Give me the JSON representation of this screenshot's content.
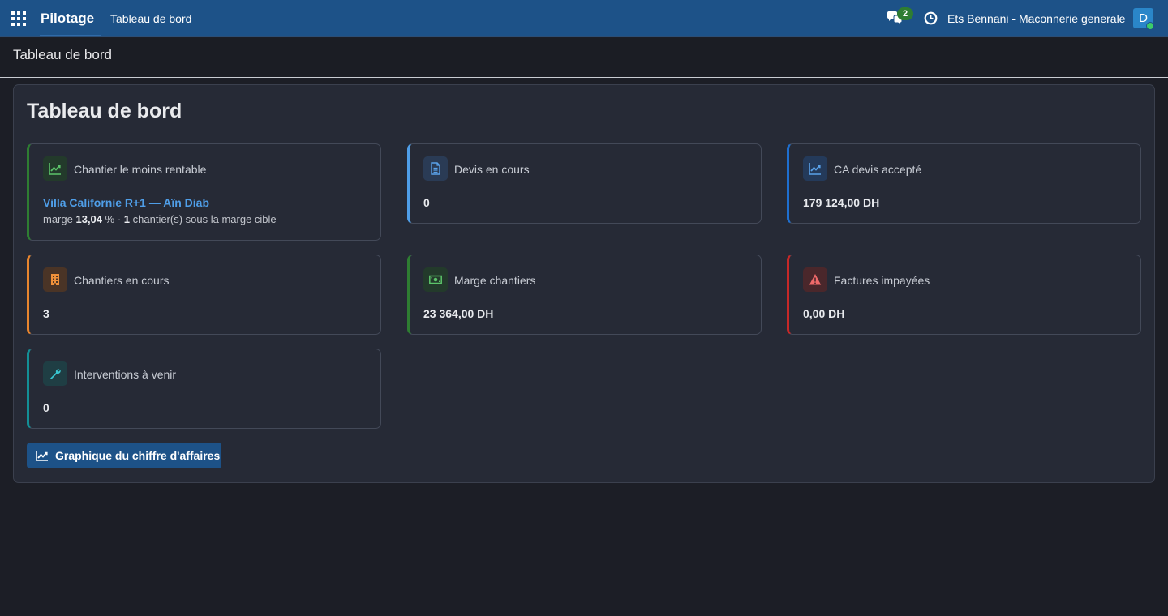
{
  "navbar": {
    "brand": "Pilotage",
    "menu_item": "Tableau de bord",
    "chat_count": "2",
    "company": "Ets Bennani - Maconnerie generale",
    "avatar_initial": "D"
  },
  "breadcrumb": "Tableau de bord",
  "dashboard": {
    "title": "Tableau de bord",
    "cards": [
      {
        "label": "Chantier le moins rentable",
        "link": "Villa Californie R+1 — Aïn Diab",
        "sub_prefix": "marge",
        "margin_value": "13,04",
        "sub_mid": "% ·",
        "count_value": "1",
        "sub_suffix": "chantier(s) sous la marge cible",
        "accent": "#2e7d32",
        "icon": "chart-line-icon"
      },
      {
        "label": "Devis en cours",
        "value": "0",
        "accent": "#4f9ee8",
        "icon": "document-icon"
      },
      {
        "label": "CA devis accepté",
        "value": "179 124,00 DH",
        "accent": "#1e6fd0",
        "icon": "chart-line-icon"
      },
      {
        "label": "Chantiers en cours",
        "value": "3",
        "accent": "#e8852e",
        "icon": "building-icon"
      },
      {
        "label": "Marge chantiers",
        "value": "23 364,00 DH",
        "accent": "#2e7d32",
        "icon": "money-icon"
      },
      {
        "label": "Factures impayées",
        "value": "0,00 DH",
        "accent": "#c62828",
        "icon": "warning-icon"
      },
      {
        "label": "Interventions à venir",
        "value": "0",
        "accent": "#138f96",
        "icon": "wrench-icon"
      }
    ],
    "chart_button": "Graphique du chiffre d'affaires"
  }
}
